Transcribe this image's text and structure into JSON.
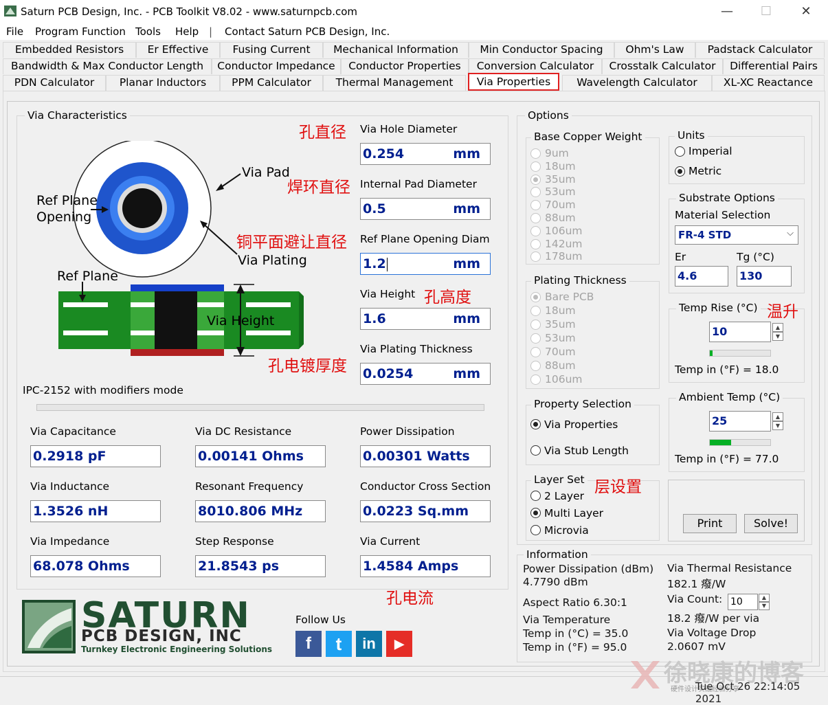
{
  "window": {
    "title": "Saturn PCB Design, Inc. - PCB Toolkit V8.02 - www.saturnpcb.com",
    "minimize": "—",
    "maximize": "☐",
    "close": "✕"
  },
  "menu": [
    "File",
    "Program Function",
    "Tools",
    "Help",
    "|",
    "Contact Saturn PCB Design, Inc."
  ],
  "tabs": {
    "row1": [
      "Embedded Resistors",
      "Er Effective",
      "Fusing Current",
      "Mechanical Information",
      "Min Conductor Spacing",
      "Ohm's Law",
      "Padstack Calculator"
    ],
    "row2": [
      "Bandwidth & Max Conductor Length",
      "Conductor Impedance",
      "Conductor Properties",
      "Conversion Calculator",
      "Crosstalk Calculator",
      "Differential Pairs"
    ],
    "row3": [
      "PDN Calculator",
      "Planar Inductors",
      "PPM Calculator",
      "Thermal Management",
      "Via Properties",
      "Wavelength Calculator",
      "XL-XC Reactance"
    ]
  },
  "via_characteristics": {
    "group_label": "Via Characteristics",
    "diagram": {
      "via_pad": "Via Pad",
      "ref_plane_opening": [
        "Ref Plane",
        "Opening"
      ],
      "via_plating": "Via Plating",
      "ref_plane": "Ref Plane",
      "via_height": "Via Height"
    },
    "hole_diameter": {
      "label": "Via Hole Diameter",
      "value": "0.254",
      "unit": "mm",
      "annotation": "孔直径"
    },
    "pad_diameter": {
      "label": "Internal Pad Diameter",
      "value": "0.5",
      "unit": "mm",
      "annotation": "焊环直径"
    },
    "plane_opening": {
      "label": "Ref Plane Opening Diam",
      "value": "1.2",
      "unit": "mm",
      "annotation": "铜平面避让直径"
    },
    "via_height": {
      "label": "Via Height",
      "value": "1.6",
      "unit": "mm",
      "annotation": "孔高度"
    },
    "plating_thickness": {
      "label": "Via Plating Thickness",
      "value": "0.0254",
      "unit": "mm",
      "annotation": "孔电镀厚度"
    },
    "mode": "IPC-2152 with modifiers mode"
  },
  "results": [
    {
      "label": "Via Capacitance",
      "value": "0.2918 pF"
    },
    {
      "label": "Via DC Resistance",
      "value": "0.00141 Ohms"
    },
    {
      "label": "Power Dissipation",
      "value": "0.00301 Watts"
    },
    {
      "label": "Via Inductance",
      "value": "1.3526 nH"
    },
    {
      "label": "Resonant Frequency",
      "value": "8010.806 MHz"
    },
    {
      "label": "Conductor Cross Section",
      "value": "0.0223 Sq.mm"
    },
    {
      "label": "Via Impedance",
      "value": "68.078 Ohms"
    },
    {
      "label": "Step Response",
      "value": "21.8543 ps"
    },
    {
      "label": "Via Current",
      "value": "1.4584 Amps"
    }
  ],
  "via_current_annotation": "孔电流",
  "logo": {
    "name": "SATURN",
    "sub": "PCB DESIGN, INC",
    "tagline": "Turnkey Electronic Engineering Solutions",
    "follow_us": "Follow Us",
    "social": [
      {
        "name": "facebook-icon",
        "glyph": "f",
        "color": "#3b5998"
      },
      {
        "name": "twitter-icon",
        "glyph": "t",
        "color": "#1da1f2"
      },
      {
        "name": "linkedin-icon",
        "glyph": "in",
        "color": "#0e76a8"
      },
      {
        "name": "youtube-icon",
        "glyph": "▶",
        "color": "#e52d27"
      }
    ]
  },
  "options": {
    "group_label": "Options",
    "base_copper": {
      "label": "Base Copper Weight",
      "items": [
        "9um",
        "18um",
        "35um",
        "53um",
        "70um",
        "88um",
        "106um",
        "142um",
        "178um"
      ],
      "selected": "35um"
    },
    "plating": {
      "label": "Plating Thickness",
      "items": [
        "Bare PCB",
        "18um",
        "35um",
        "53um",
        "70um",
        "88um",
        "106um"
      ],
      "selected": "Bare PCB"
    },
    "units": {
      "label": "Units",
      "items": [
        "Imperial",
        "Metric"
      ],
      "selected": "Metric"
    },
    "substrate": {
      "label": "Substrate Options",
      "material_label": "Material Selection",
      "material": "FR-4 STD",
      "er_label": "Er",
      "er": "4.6",
      "tg_label": "Tg (°C)",
      "tg": "130"
    },
    "temp_rise": {
      "label": "Temp Rise (°C)",
      "annotation": "温升",
      "value": "10",
      "progress": 0.05,
      "f_label": "Temp in (°F)  =  18.0"
    },
    "ambient": {
      "label": "Ambient Temp (°C)",
      "value": "25",
      "progress": 0.35,
      "f_label": "Temp in (°F)  =  77.0"
    },
    "property": {
      "label": "Property Selection",
      "items": [
        "Via Properties",
        "Via Stub Length"
      ],
      "selected": "Via Properties"
    },
    "layer_set": {
      "label": "Layer Set",
      "annotation": "层设置",
      "items": [
        "2 Layer",
        "Multi Layer",
        "Microvia"
      ],
      "selected": "Multi Layer"
    },
    "print": "Print",
    "solve": "Solve!"
  },
  "information": {
    "label": "Information",
    "power_dbm_label": "Power Dissipation (dBm)",
    "power_dbm": "4.7790 dBm",
    "aspect_ratio": "Aspect Ratio  6.30:1",
    "via_temp_label": "Via Temperature",
    "temp_c": "Temp in (°C)  =  35.0",
    "temp_f": "Temp in (°F)  =  95.0",
    "thermal_res_label": "Via Thermal Resistance",
    "thermal_res": "182.1 癈/W",
    "via_count_label": "Via Count:",
    "via_count": "10",
    "per_via": "18.2 癈/W per via",
    "voltage_drop_label": "Via Voltage Drop",
    "voltage_drop": "2.0607 mV"
  },
  "status": {
    "date": "Tue Oct 26 22:14:05 2021",
    "watermark": "徐晓康的博客",
    "watermark_sub": "硬件设计实战经验分享"
  }
}
